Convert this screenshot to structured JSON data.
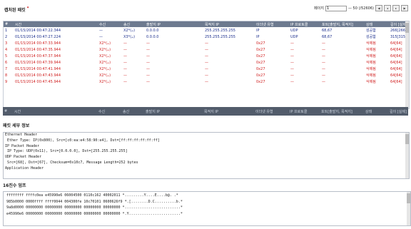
{
  "header": {
    "title": "캡처된 패킷",
    "pager_label": "페이지",
    "page_value": "1",
    "page_total": "— 50 (/52606)"
  },
  "columns": [
    "#",
    "시간",
    "",
    "수신",
    "송신",
    "출발지 IP",
    "목적지 IP",
    "이더넷 유형",
    "IP 프로토콜",
    "포트[출발지, 목적지]",
    "상태",
    "길이 [실제]"
  ],
  "rows": [
    {
      "no": "1",
      "time": "01/15/2014 00:47:22.344",
      "recv": "—",
      "send": "X2*(ᴗ)",
      "src": "0.0.0.0",
      "dst": "255.255.255.255",
      "eth": "IP",
      "proto": "UDP",
      "ports": "68,67",
      "status": "성공함",
      "len": "266[266]",
      "kind": "normal"
    },
    {
      "no": "2",
      "time": "01/15/2014 00:47:27.224",
      "recv": "—",
      "send": "X3*(ᴗ)",
      "src": "0.0.0.0",
      "dst": "255.255.255.255",
      "eth": "IP",
      "proto": "UDP",
      "ports": "68,67",
      "status": "성공함",
      "len": "315[315]",
      "kind": "normal"
    },
    {
      "no": "3",
      "time": "01/15/2014 00:47:33.944",
      "recv": "X2*(ᴗ)",
      "send": "—",
      "src": "—",
      "dst": "—",
      "eth": "0x27",
      "proto": "—",
      "ports": "—",
      "status": "삭제됨",
      "len": "64[64]",
      "kind": "error"
    },
    {
      "no": "4",
      "time": "01/15/2014 00:47:35.944",
      "recv": "X2*(ᴗ)",
      "send": "—",
      "src": "—",
      "dst": "—",
      "eth": "0x27",
      "proto": "—",
      "ports": "—",
      "status": "삭제됨",
      "len": "64[64]",
      "kind": "error"
    },
    {
      "no": "5",
      "time": "01/15/2014 00:47:37.944",
      "recv": "X2*(ᴗ)",
      "send": "—",
      "src": "—",
      "dst": "—",
      "eth": "0x27",
      "proto": "—",
      "ports": "—",
      "status": "삭제됨",
      "len": "64[64]",
      "kind": "error"
    },
    {
      "no": "6",
      "time": "01/15/2014 00:47:39.944",
      "recv": "X2*(ᴗ)",
      "send": "—",
      "src": "—",
      "dst": "—",
      "eth": "0x27",
      "proto": "—",
      "ports": "—",
      "status": "삭제됨",
      "len": "64[64]",
      "kind": "error"
    },
    {
      "no": "7",
      "time": "01/15/2014 00:47:41.944",
      "recv": "X2*(ᴗ)",
      "send": "—",
      "src": "—",
      "dst": "—",
      "eth": "0x27",
      "proto": "—",
      "ports": "—",
      "status": "삭제됨",
      "len": "64[64]",
      "kind": "error"
    },
    {
      "no": "8",
      "time": "01/15/2014 00:47:43.944",
      "recv": "X2*(ᴗ)",
      "send": "—",
      "src": "—",
      "dst": "—",
      "eth": "0x27",
      "proto": "—",
      "ports": "—",
      "status": "삭제됨",
      "len": "64[64]",
      "kind": "error"
    },
    {
      "no": "9",
      "time": "01/15/2014 00:47:45.944",
      "recv": "X2*(ᴗ)",
      "send": "—",
      "src": "—",
      "dst": "—",
      "eth": "0x27",
      "proto": "—",
      "ports": "—",
      "status": "삭제됨",
      "len": "64[64]",
      "kind": "error"
    }
  ],
  "detail": {
    "title": "패킷 세부 정보",
    "lines": [
      "Ethernet Header",
      " Ether Type: IP(0x800), Src=[c0:ea:e4:58:90:e4], Dst=[ff:ff:ff:ff:ff:ff]",
      "IP Packet Header",
      " IP Type: UDP(0x11), Src=[0.0.0.0], Dst=[255.255.255.255]",
      "UDP Packet Header",
      " Src=[68], Dst=[67], Checksum=0x10c7, Message Length=252 bytes",
      "Application Header",
      ""
    ]
  },
  "hex": {
    "title": "16진수 덤프",
    "lines": [
      "ffffffff ffffc0ea e45990e6 06004500 0110c162 40002011 *.........Y....E....b@. .*",
      "985b0000 0000ffff ffff0044 004300fe 10c70101 0600626f9 *.[........D.C..........b.*",
      "9a8d0000 00000000 00000000 00000000 00000000 00000000 *..........................*",
      "e45990e6 00000000 00000000 00000000 00000000 00000000 *.Y........................*"
    ]
  },
  "colors": {
    "header_bg": "#6d7a8f",
    "normal_row": "#1a2d8c",
    "error_row": "#d02020"
  }
}
